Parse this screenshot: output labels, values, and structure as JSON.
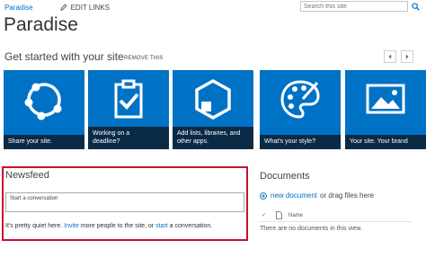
{
  "topnav": {
    "site_link": "Paradise",
    "edit_links": "EDIT LINKS"
  },
  "search": {
    "placeholder": "Search this site"
  },
  "site_title": "Paradise",
  "get_started": {
    "heading": "Get started with your site",
    "remove_label": "REMOVE THIS",
    "tiles": [
      {
        "label": "Share your site.",
        "icon": "share-icon"
      },
      {
        "label": "Working on a deadline?",
        "icon": "clipboard-check-icon"
      },
      {
        "label": "Add lists, libraries, and other apps.",
        "icon": "add-app-icon"
      },
      {
        "label": "What's your style?",
        "icon": "palette-icon"
      },
      {
        "label": "Your site. Your brand.",
        "icon": "picture-icon"
      }
    ],
    "tile_lines": [
      [
        "Share your site."
      ],
      [
        "Working on a",
        "deadline?"
      ],
      [
        "Add lists, libraries, and",
        "other apps."
      ],
      [
        "What's your style?"
      ],
      [
        "Your site. Your brand"
      ]
    ]
  },
  "newsfeed": {
    "title": "Newsfeed",
    "conversation_placeholder": "Start a conversation",
    "quiet_prefix": "It's pretty quiet here. ",
    "invite_link": "Invite",
    "quiet_middle": " more people to the site, or ",
    "start_link": "start",
    "quiet_suffix": " a conversation."
  },
  "documents": {
    "title": "Documents",
    "new_document": "new document",
    "drag_text": "or drag files here",
    "check_mark": "✓",
    "name_column": "Name",
    "empty_text": "There are no documents in this view."
  },
  "colors": {
    "tile_blue": "#0072c6",
    "tile_label_bg": "#0a2a46",
    "link_blue": "#0072c6",
    "highlight_red": "#c8102e"
  }
}
